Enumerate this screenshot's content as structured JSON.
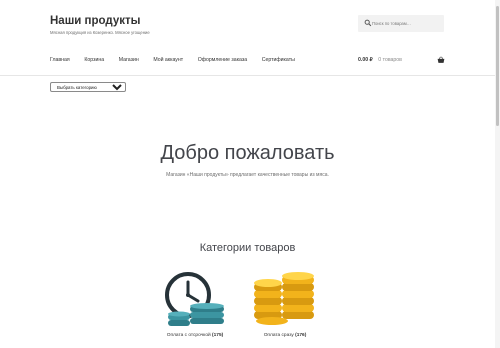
{
  "header": {
    "site_title": "Наши продукты",
    "site_description": "Мясная продукция из Козеренко. Мясное угощение"
  },
  "search": {
    "placeholder": "Поиск по товарам…",
    "value": ""
  },
  "nav": {
    "items": [
      "Главная",
      "Корзина",
      "Магазин",
      "Мой аккаунт",
      "Оформление заказа",
      "Сертификаты"
    ]
  },
  "cart": {
    "total": "0.00 ₽",
    "count": "0 товаров"
  },
  "category_filter": {
    "selected": "Выбрать категорию"
  },
  "hero": {
    "title": "Добро пожаловать",
    "text": "Магазин «Наши продукты» предлагает качественные товары из мяса."
  },
  "categories": {
    "title": "Категории товаров",
    "items": [
      {
        "name": "Оплата с отсрочкой",
        "count": "(175)",
        "icon": "clock-coins-icon"
      },
      {
        "name": "Оплата сразу",
        "count": "(176)",
        "icon": "gold-coins-icon"
      }
    ]
  },
  "colors": {
    "accent": "#2f7e8a",
    "gold": "#f2b31b",
    "text": "#43454b"
  }
}
